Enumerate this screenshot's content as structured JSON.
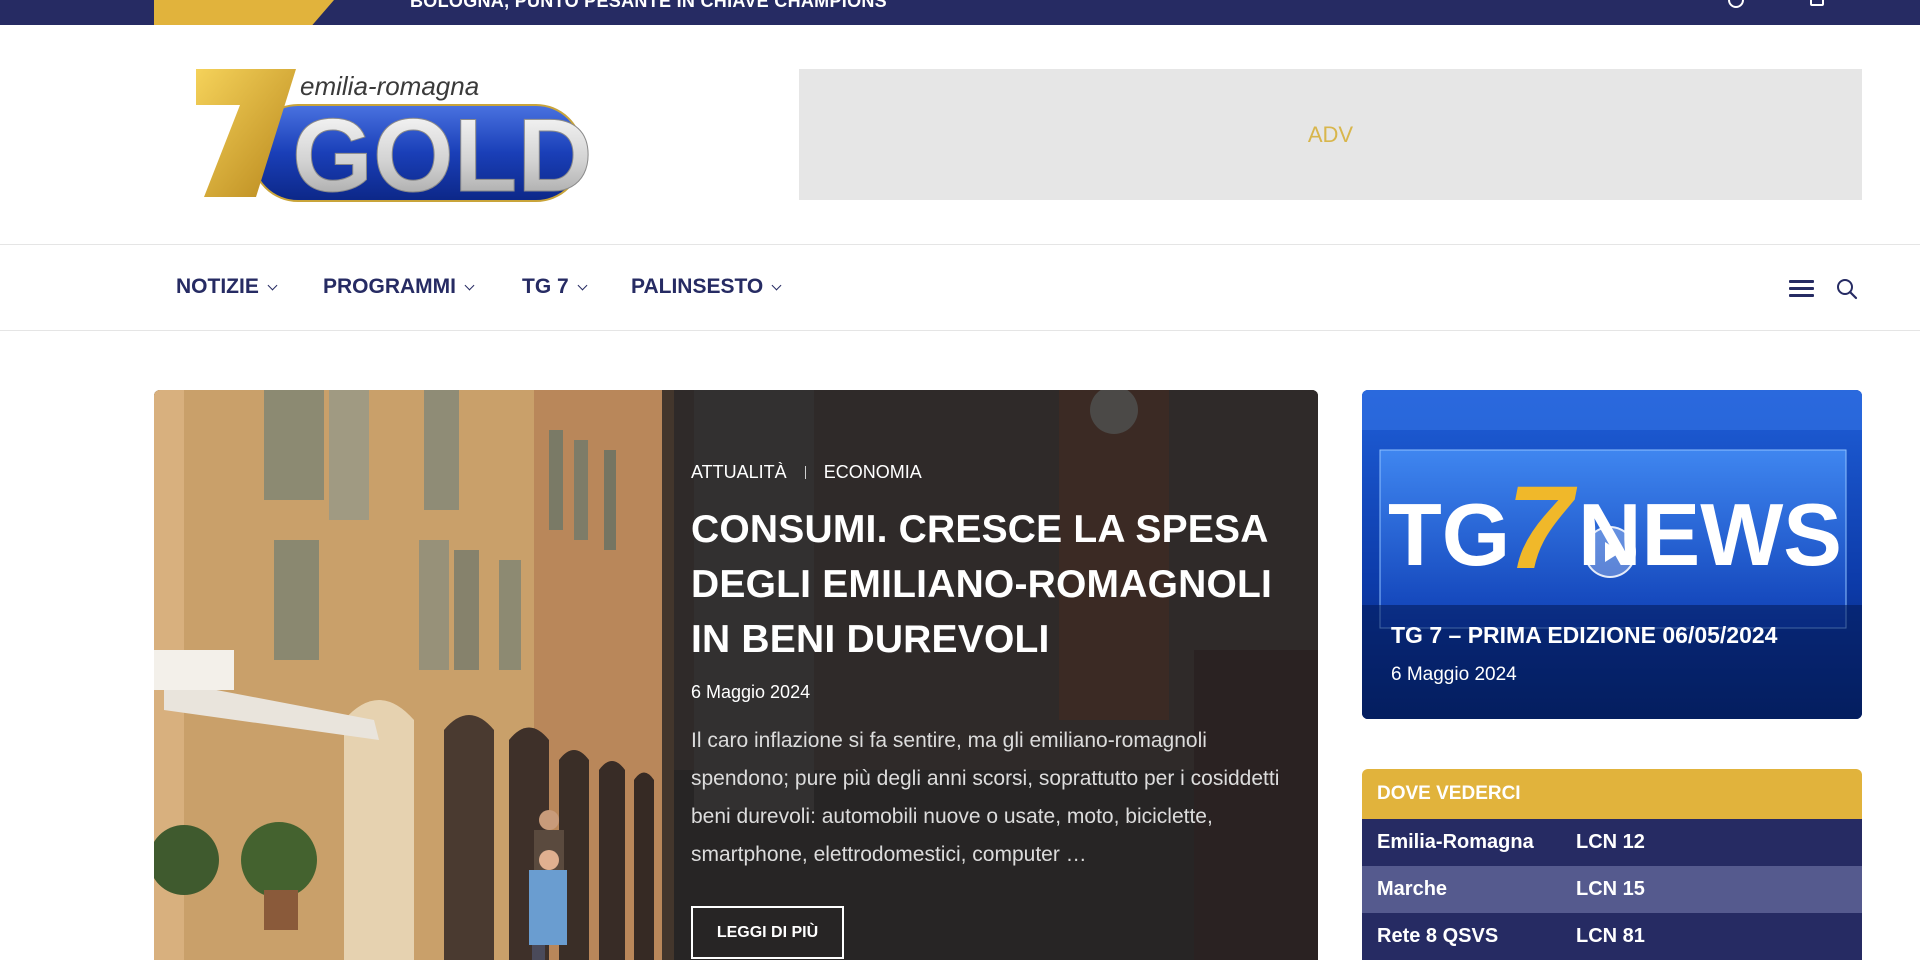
{
  "topbar": {
    "ticker": "BOLOGNA, PUNTO PESANTE IN CHIAVE CHAMPIONS",
    "icons": [
      "search-icon",
      "account-icon"
    ]
  },
  "header": {
    "logo": {
      "region_text": "emilia-romagna",
      "brand_text": "GOLD",
      "number": "7"
    },
    "adv_label": "ADV"
  },
  "nav": {
    "items": [
      {
        "label": "NOTIZIE"
      },
      {
        "label": "PROGRAMMI"
      },
      {
        "label": "TG 7"
      },
      {
        "label": "PALINSESTO"
      }
    ],
    "icons": [
      "menu-icon",
      "search-icon"
    ]
  },
  "hero": {
    "categories": [
      "ATTUALITÀ",
      "ECONOMIA"
    ],
    "title": "CONSUMI. CRESCE LA SPESA DEGLI EMILIANO-ROMAGNOLI IN BENI DUREVOLI",
    "date": "6 Maggio 2024",
    "excerpt": "Il caro inflazione si fa sentire, ma gli emiliano-romagnoli spendono; pure più degli anni scorsi, soprattutto per i cosiddetti beni durevoli: automobili nuove o usate, moto, biciclette, smartphone, elettrodomestici, computer …",
    "read_more": "LEGGI DI PIÙ"
  },
  "video": {
    "logo_text_left": "TG",
    "logo_number": "7",
    "logo_text_right": "NEWS",
    "title": "TG 7 – PRIMA EDIZIONE 06/05/2024",
    "date": "6 Maggio 2024"
  },
  "channels": {
    "heading": "DOVE VEDERCI",
    "rows": [
      {
        "region": "Emilia-Romagna",
        "lcn": "LCN 12"
      },
      {
        "region": "Marche",
        "lcn": "LCN 15"
      },
      {
        "region": "Rete 8 QSVS",
        "lcn": "LCN 81"
      }
    ]
  },
  "colors": {
    "navy": "#262b63",
    "gold": "#e1b33c",
    "row_alt": "#555a8e"
  }
}
